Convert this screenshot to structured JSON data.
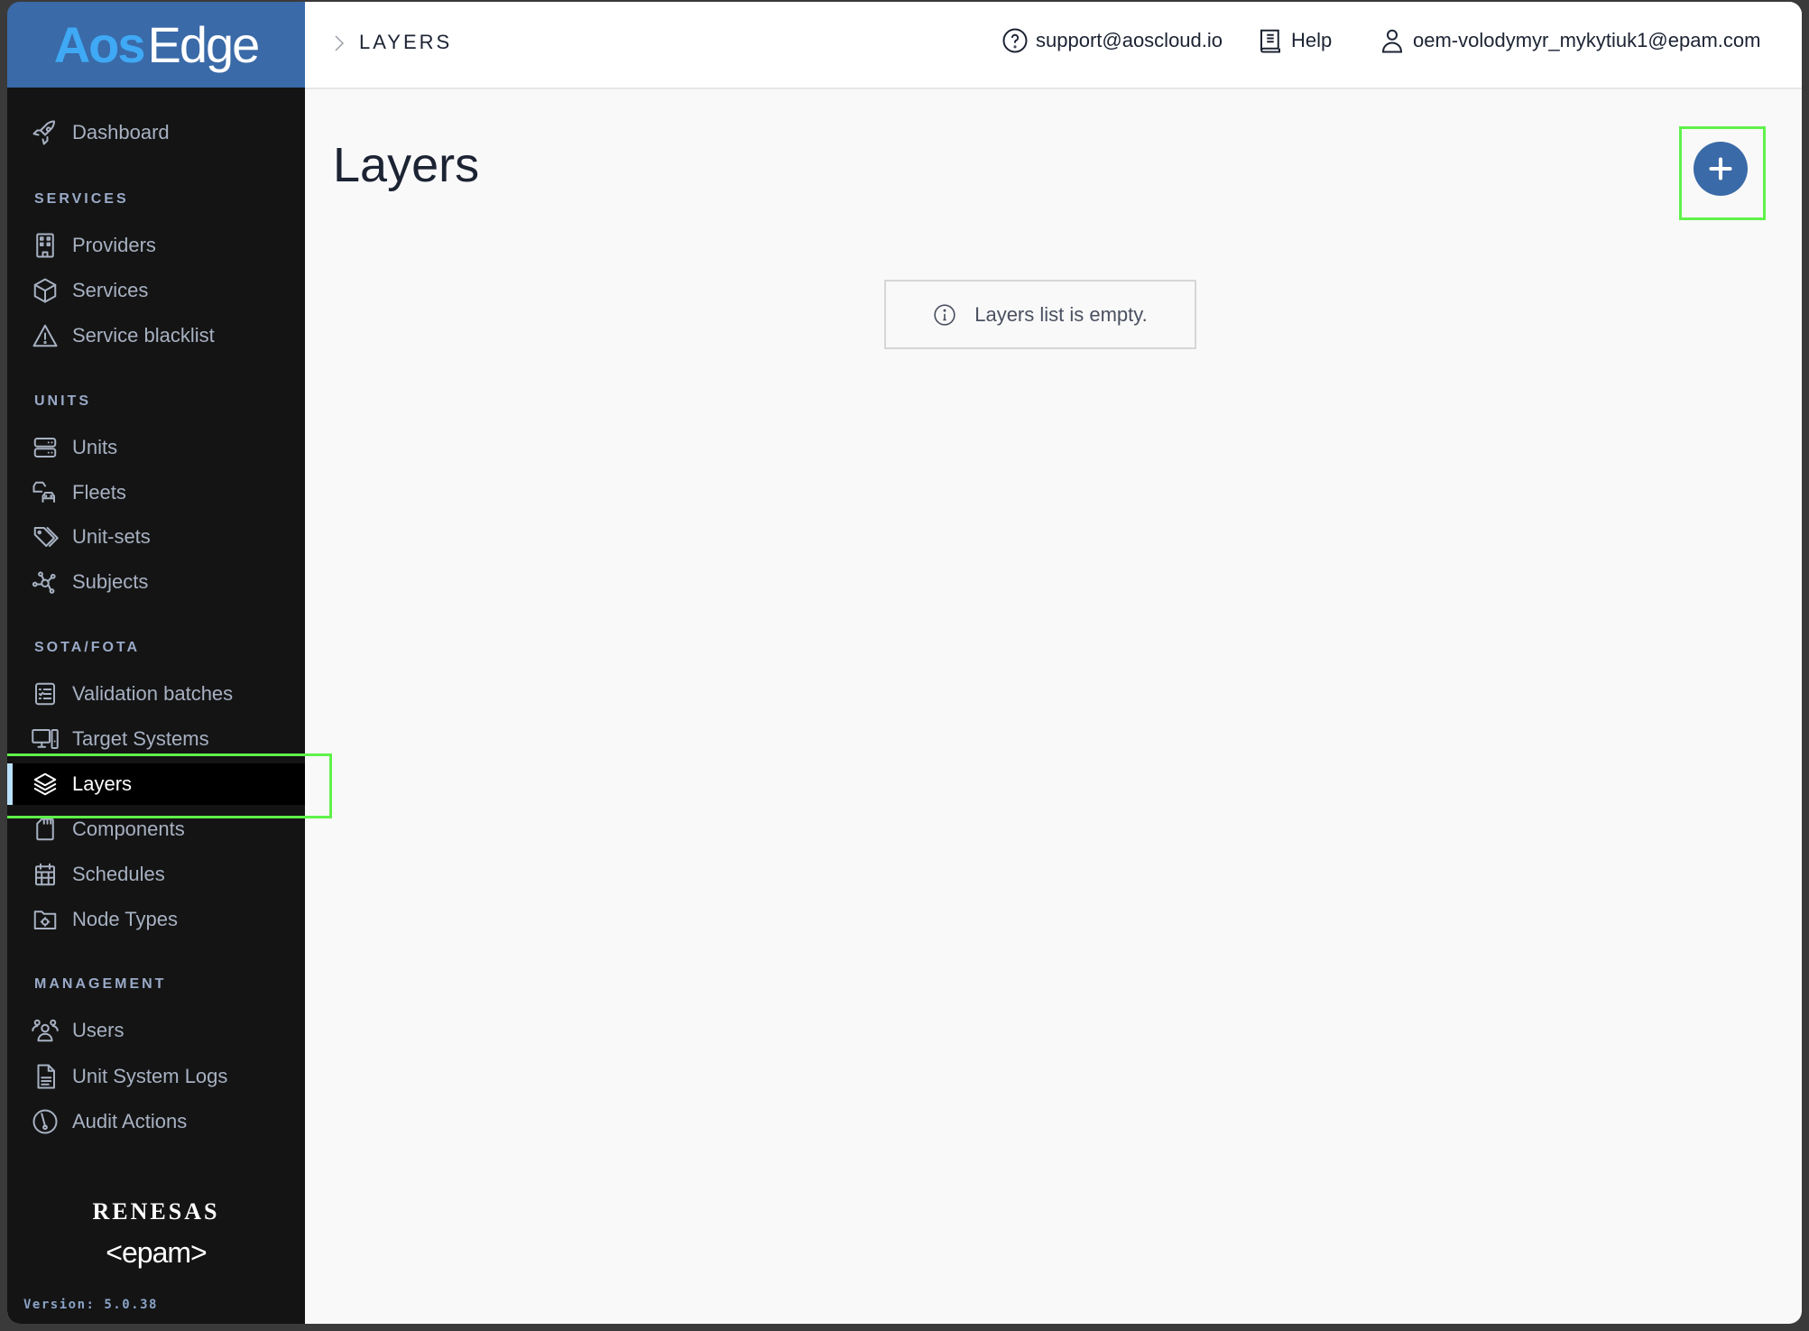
{
  "app": {
    "logo_primary": "Aos",
    "logo_secondary": "Edge"
  },
  "header": {
    "breadcrumb": "LAYERS",
    "support_email": "support@aoscloud.io",
    "help_label": "Help",
    "user_email": "oem-volodymyr_mykytiuk1@epam.com"
  },
  "sidebar": {
    "dashboard": "Dashboard",
    "sections": [
      {
        "title": "SERVICES",
        "items": [
          {
            "label": "Providers",
            "icon": "building-icon"
          },
          {
            "label": "Services",
            "icon": "cube-icon"
          },
          {
            "label": "Service blacklist",
            "icon": "warning-icon"
          }
        ]
      },
      {
        "title": "UNITS",
        "items": [
          {
            "label": "Units",
            "icon": "server-icon"
          },
          {
            "label": "Fleets",
            "icon": "cars-icon"
          },
          {
            "label": "Unit-sets",
            "icon": "tags-icon"
          },
          {
            "label": "Subjects",
            "icon": "network-icon"
          }
        ]
      },
      {
        "title": "SOTA/FOTA",
        "items": [
          {
            "label": "Validation batches",
            "icon": "checklist-icon"
          },
          {
            "label": "Target Systems",
            "icon": "computer-icon"
          },
          {
            "label": "Layers",
            "icon": "layers-icon",
            "active": true
          },
          {
            "label": "Components",
            "icon": "sd-card-icon"
          },
          {
            "label": "Schedules",
            "icon": "calendar-icon"
          },
          {
            "label": "Node Types",
            "icon": "folder-gear-icon"
          }
        ]
      },
      {
        "title": "MANAGEMENT",
        "items": [
          {
            "label": "Users",
            "icon": "users-icon"
          },
          {
            "label": "Unit System Logs",
            "icon": "document-icon"
          },
          {
            "label": "Audit Actions",
            "icon": "gauge-icon"
          }
        ]
      }
    ],
    "brand_1": "RENESAS",
    "brand_2": "<epam>",
    "version": "Version: 5.0.38"
  },
  "main": {
    "title": "Layers",
    "empty_message": "Layers list is empty.",
    "add_button_label": "+"
  },
  "colors": {
    "brand_blue": "#3a6aa8",
    "logo_accent": "#3fa9f5",
    "sidebar_bg": "#141414",
    "active_indicator": "#b9e0fb",
    "highlight_box": "#5ff24a"
  }
}
